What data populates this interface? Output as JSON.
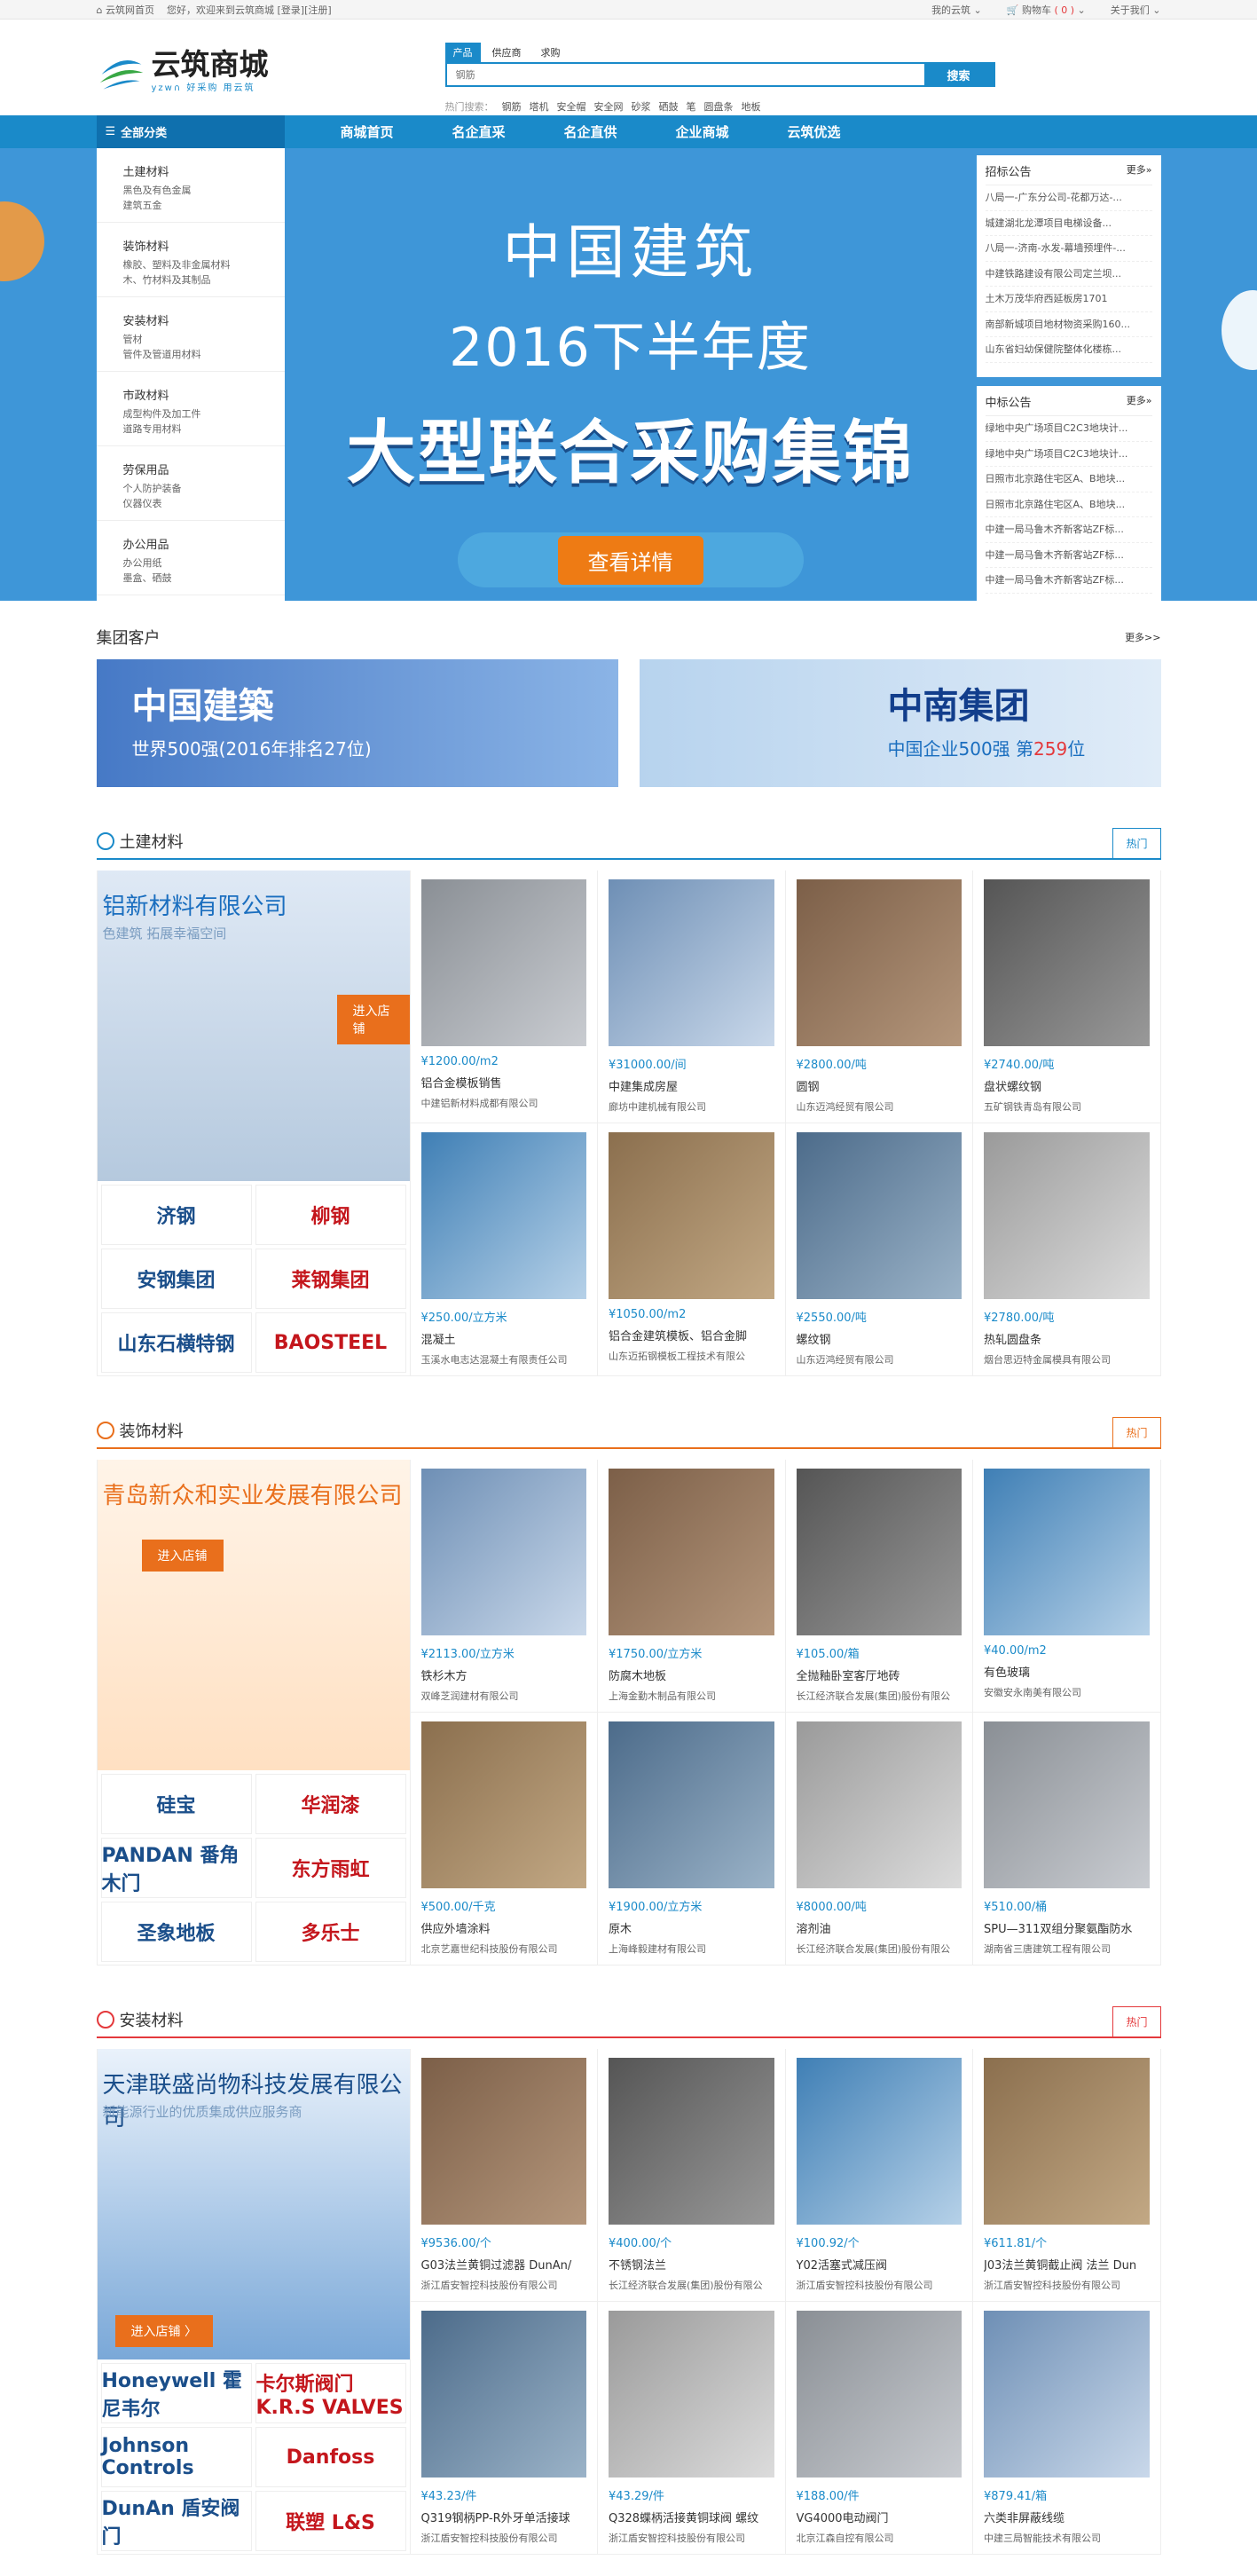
{
  "topbar": {
    "home": "云筑网首页",
    "welcome": "您好，欢迎来到云筑商城",
    "login": "[登录]",
    "register": "[注册]",
    "my": "我的云筑",
    "cart_label": "购物车",
    "cart_count": "( 0 )",
    "about": "关于我们"
  },
  "logo": {
    "name": "云筑商城",
    "sub": "yzw∩ 好采购 用云筑"
  },
  "search": {
    "tabs": [
      "产品",
      "供应商",
      "求购"
    ],
    "placeholder": "钢筋",
    "button": "搜索",
    "hot_label": "热门搜索：",
    "hot": [
      "钢筋",
      "塔机",
      "安全帽",
      "安全网",
      "砂浆",
      "硒鼓",
      "笔",
      "圆盘条",
      "地板"
    ]
  },
  "nav": {
    "all": "全部分类",
    "links": [
      "商城首页",
      "名企直采",
      "名企直供",
      "企业商城",
      "云筑优选"
    ]
  },
  "categories": [
    {
      "title": "土建材料",
      "desc": [
        "黑色及有色金属",
        "建筑五金"
      ]
    },
    {
      "title": "装饰材料",
      "desc": [
        "橡胶、塑料及非金属材料",
        "木、竹材料及其制品"
      ]
    },
    {
      "title": "安装材料",
      "desc": [
        "管材",
        "管件及管道用材料"
      ]
    },
    {
      "title": "市政材料",
      "desc": [
        "成型构件及加工件",
        "道路专用材料"
      ]
    },
    {
      "title": "劳保用品",
      "desc": [
        "个人防护装备",
        "仪器仪表"
      ]
    },
    {
      "title": "办公用品",
      "desc": [
        "办公用纸",
        "墨盒、硒鼓"
      ]
    }
  ],
  "banner": {
    "line1": "中国建筑",
    "line2": "2016下半年度",
    "line3": "大型联合采购集锦",
    "cta": "查看详情"
  },
  "notices": [
    {
      "title": "招标公告",
      "more": "更多»",
      "items": [
        "八局一-广东分公司-花都万达-...",
        "城建湖北龙潭项目电梯设备...",
        "八局一-济南-水发-幕墙预埋件-...",
        "中建铁路建设有限公司定兰坝...",
        "土木万茂华府西延板房1701",
        "南部新城项目地材物资采购160...",
        "山东省妇幼保健院整体化楼栋..."
      ]
    },
    {
      "title": "中标公告",
      "more": "更多»",
      "items": [
        "绿地中央广场项目C2C3地块计...",
        "绿地中央广场项目C2C3地块计...",
        "日照市北京路住宅区A、B地块...",
        "日照市北京路住宅区A、B地块...",
        "中建一局马鲁木齐新客站ZF标...",
        "中建一局马鲁木齐新客站ZF标...",
        "中建一局马鲁木齐新客站ZF标..."
      ]
    }
  ],
  "group": {
    "title": "集团客户",
    "more": "更多>>",
    "cards": [
      {
        "name": "中国建築",
        "tag_pre": "世界500强(2016年排名",
        "tag_num": "27",
        "tag_post": "位)"
      },
      {
        "name": "中南集团",
        "tag_pre": "中国企业500强 第",
        "tag_num": "259",
        "tag_post": "位"
      }
    ]
  },
  "floors": [
    {
      "title": "土建材料",
      "tab": "热门",
      "color": "#1a8ac9",
      "ad": {
        "co": "铝新材料有限公司",
        "sub": "色建筑  拓展幸福空间",
        "btn": "进入店铺"
      },
      "brands": [
        "济钢",
        "柳钢",
        "安钢集团",
        "莱钢集团",
        "山东石横特钢",
        "BAOSTEEL"
      ],
      "goods": [
        {
          "price": "¥1200.00/m2",
          "name": "铝合金模板销售",
          "co": "中建铝新材料成都有限公司"
        },
        {
          "price": "¥31000.00/间",
          "name": "中建集成房屋",
          "co": "廊坊中建机械有限公司"
        },
        {
          "price": "¥2800.00/吨",
          "name": "圆钢",
          "co": "山东迈鸿经贸有限公司"
        },
        {
          "price": "¥2740.00/吨",
          "name": "盘状螺纹钢",
          "co": "五矿钢铁青岛有限公司"
        },
        {
          "price": "¥250.00/立方米",
          "name": "混凝土",
          "co": "玉溪水电志达混凝土有限责任公司"
        },
        {
          "price": "¥1050.00/m2",
          "name": "铝合金建筑模板、铝合金脚",
          "co": "山东迈拓钢模板工程技术有限公"
        },
        {
          "price": "¥2550.00/吨",
          "name": "螺纹钢",
          "co": "山东迈鸿经贸有限公司"
        },
        {
          "price": "¥2780.00/吨",
          "name": "热轧圆盘条",
          "co": "烟台思迈特金属模具有限公司"
        }
      ]
    },
    {
      "title": "装饰材料",
      "tab": "热门",
      "color": "#e96f1c",
      "ad": {
        "co": "青岛新众和实业发展有限公司",
        "sub": "",
        "btn": "进入店铺"
      },
      "brands": [
        "硅宝",
        "华润漆",
        "PANDAN 番角木门",
        "东方雨虹",
        "圣象地板",
        "多乐士"
      ],
      "goods": [
        {
          "price": "¥2113.00/立方米",
          "name": "铁杉木方",
          "co": "双峰芝润建材有限公司"
        },
        {
          "price": "¥1750.00/立方米",
          "name": "防腐木地板",
          "co": "上海金勤木制品有限公司"
        },
        {
          "price": "¥105.00/箱",
          "name": "全抛釉卧室客厅地砖",
          "co": "长江经济联合发展(集团)股份有限公"
        },
        {
          "price": "¥40.00/m2",
          "name": "有色玻璃",
          "co": "安徽安永南美有限公司"
        },
        {
          "price": "¥500.00/千克",
          "name": "供应外墙涂料",
          "co": "北京艺嘉世纪科技股份有限公司"
        },
        {
          "price": "¥1900.00/立方米",
          "name": "原木",
          "co": "上海峰毅建材有限公司"
        },
        {
          "price": "¥8000.00/吨",
          "name": "溶剂油",
          "co": "长江经济联合发展(集团)股份有限公"
        },
        {
          "price": "¥510.00/桶",
          "name": "SPU—311双组分聚氨酯防水",
          "co": "湖南省三唐建筑工程有限公司"
        }
      ]
    },
    {
      "title": "安装材料",
      "tab": "热门",
      "color": "#e4393c",
      "ad": {
        "co": "天津联盛尚物科技发展有限公司",
        "sub": "新能源行业的优质集成供应服务商",
        "btn": "进入店铺 〉"
      },
      "brands": [
        "Honeywell 霍尼韦尔",
        "卡尔斯阀门 K.R.S VALVES",
        "Johnson Controls",
        "Danfoss",
        "DunAn 盾安阀门",
        "联塑 L&S"
      ],
      "goods": [
        {
          "price": "¥9536.00/个",
          "name": "G03法兰黄铜过滤器 DunAn/",
          "co": "浙江盾安智控科技股份有限公司"
        },
        {
          "price": "¥400.00/个",
          "name": "不锈钢法兰",
          "co": "长江经济联合发展(集团)股份有限公"
        },
        {
          "price": "¥100.92/个",
          "name": "Y02活塞式减压阀",
          "co": "浙江盾安智控科技股份有限公司"
        },
        {
          "price": "¥611.81/个",
          "name": "J03法兰黄铜截止阀 法兰 Dun",
          "co": "浙江盾安智控科技股份有限公司"
        },
        {
          "price": "¥43.23/件",
          "name": "Q319钢柄PP-R外牙单活接球",
          "co": "浙江盾安智控科技股份有限公司"
        },
        {
          "price": "¥43.29/件",
          "name": "Q328蝶柄活接黄铜球阀 螺纹",
          "co": "浙江盾安智控科技股份有限公司"
        },
        {
          "price": "¥188.00/件",
          "name": "VG4000电动阀门",
          "co": "北京江森自控有限公司"
        },
        {
          "price": "¥879.41/箱",
          "name": "六类非屏蔽线缆",
          "co": "中建三局智能技术有限公司"
        }
      ]
    }
  ]
}
